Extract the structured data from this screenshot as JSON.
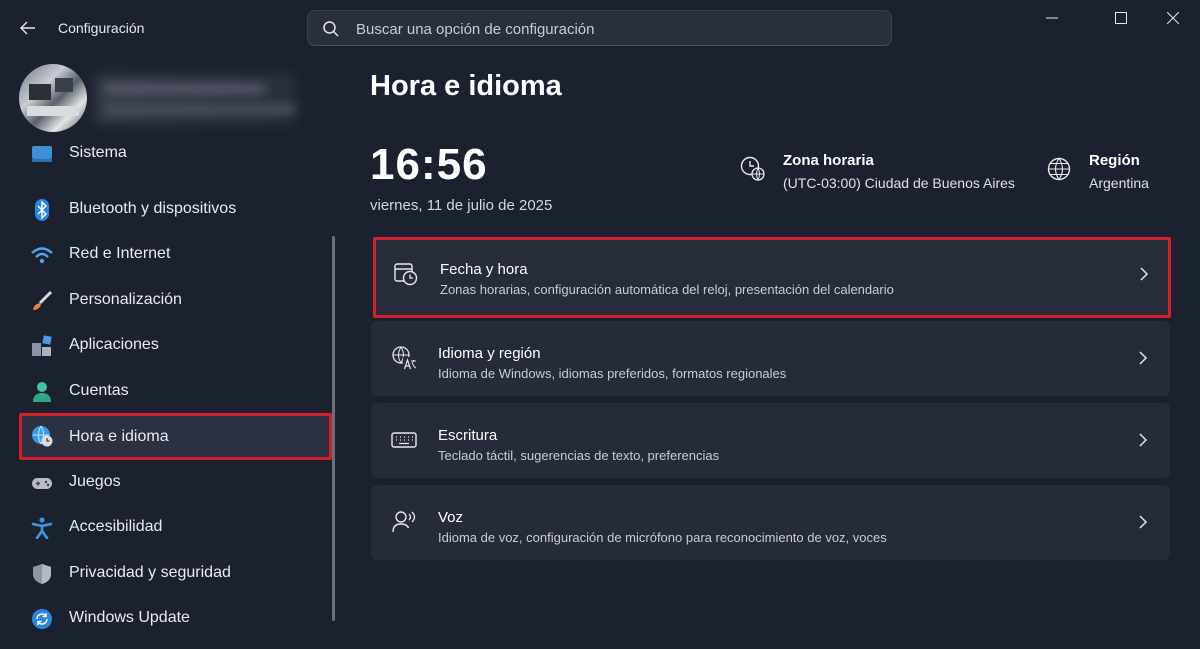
{
  "window": {
    "title": "Configuración",
    "controls": {
      "minimize": "minimize-icon",
      "maximize": "maximize-icon",
      "close": "close-icon"
    }
  },
  "search": {
    "placeholder": "Buscar una opción de configuración"
  },
  "sidebar": {
    "items": [
      {
        "label": "Sistema",
        "icon": "system-icon"
      },
      {
        "label": "Bluetooth y dispositivos",
        "icon": "bluetooth-icon"
      },
      {
        "label": "Red e Internet",
        "icon": "wifi-icon"
      },
      {
        "label": "Personalización",
        "icon": "brush-icon"
      },
      {
        "label": "Aplicaciones",
        "icon": "apps-icon"
      },
      {
        "label": "Cuentas",
        "icon": "account-icon"
      },
      {
        "label": "Hora e idioma",
        "icon": "time-language-icon",
        "active": true
      },
      {
        "label": "Juegos",
        "icon": "gamepad-icon"
      },
      {
        "label": "Accesibilidad",
        "icon": "accessibility-icon"
      },
      {
        "label": "Privacidad y seguridad",
        "icon": "shield-icon"
      },
      {
        "label": "Windows Update",
        "icon": "update-icon"
      }
    ]
  },
  "main": {
    "title": "Hora e idioma",
    "clock": {
      "time": "16:56",
      "date": "viernes, 11 de julio de 2025"
    },
    "timezone": {
      "title": "Zona horaria",
      "value": "(UTC-03:00) Ciudad de Buenos Aires"
    },
    "region": {
      "title": "Región",
      "value": "Argentina"
    },
    "cards": [
      {
        "title": "Fecha y hora",
        "subtitle": "Zonas horarias, configuración automática del reloj, presentación del calendario",
        "icon": "calendar-clock-icon"
      },
      {
        "title": "Idioma y región",
        "subtitle": "Idioma de Windows, idiomas preferidos, formatos regionales",
        "icon": "language-icon"
      },
      {
        "title": "Escritura",
        "subtitle": "Teclado táctil, sugerencias de texto, preferencias",
        "icon": "keyboard-icon"
      },
      {
        "title": "Voz",
        "subtitle": "Idioma de voz, configuración de micrófono para reconocimiento de voz, voces",
        "icon": "voice-icon"
      }
    ]
  },
  "colors": {
    "background": "#1c2130",
    "card": "#262b3a",
    "highlight": "#d0202a",
    "accent": "#4cc2ff"
  }
}
